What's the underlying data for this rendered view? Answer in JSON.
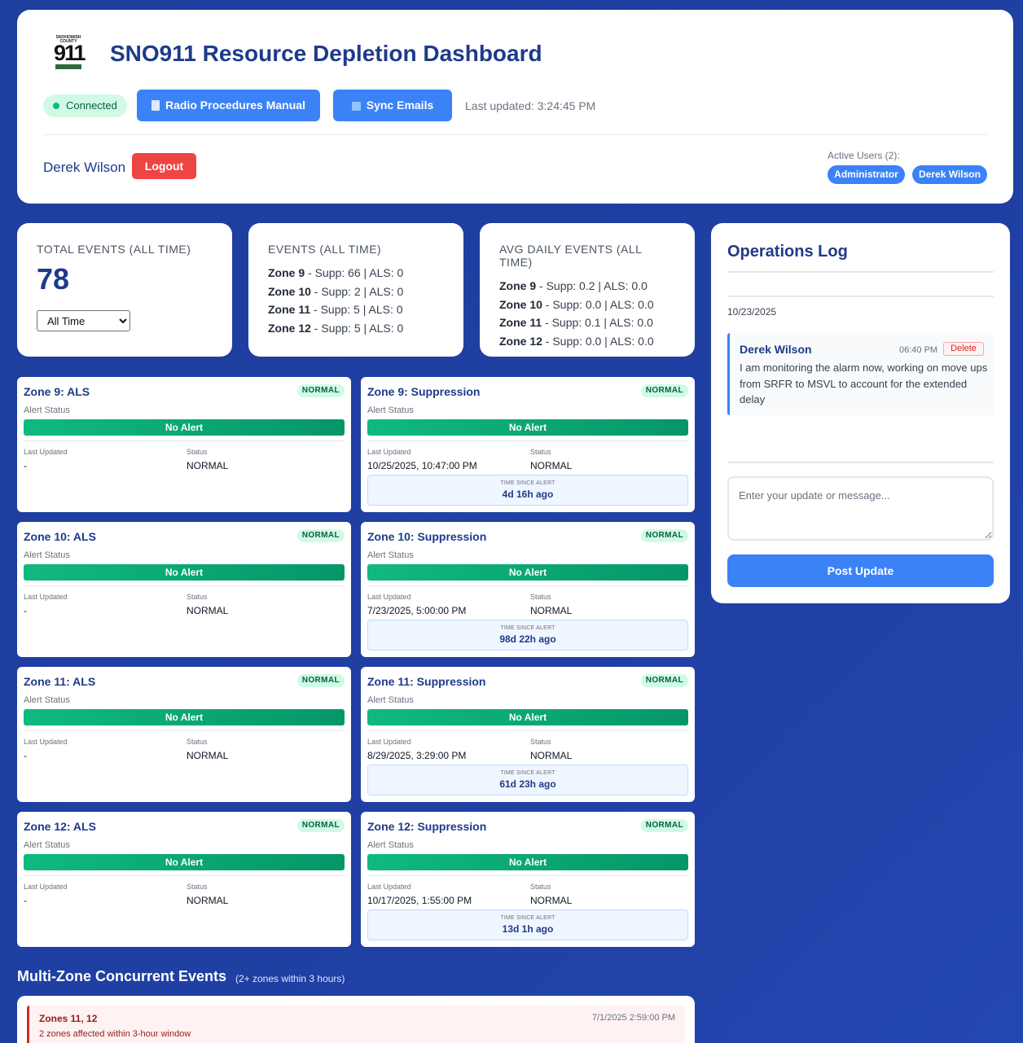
{
  "header": {
    "logo": {
      "top_text": "SNOHOMISH COUNTY",
      "number": "911"
    },
    "title": "SNO911 Resource Depletion Dashboard",
    "connection_status": "Connected",
    "radio_manual_label": "Radio Procedures Manual",
    "sync_emails_label": "Sync Emails",
    "last_updated": "Last updated: 3:24:45 PM",
    "username": "Derek Wilson",
    "logout_label": "Logout",
    "active_users_label": "Active Users (2):",
    "active_users": [
      "Administrator",
      "Derek Wilson"
    ]
  },
  "stats": {
    "total": {
      "title": "TOTAL EVENTS (ALL TIME)",
      "value": "78",
      "range_selected": "All Time"
    },
    "events": {
      "title": "EVENTS (ALL TIME)",
      "rows": [
        {
          "zone": "Zone 9",
          "detail": " - Supp: 66 | ALS: 0"
        },
        {
          "zone": "Zone 10",
          "detail": " - Supp: 2 | ALS: 0"
        },
        {
          "zone": "Zone 11",
          "detail": " - Supp: 5 | ALS: 0"
        },
        {
          "zone": "Zone 12",
          "detail": " - Supp: 5 | ALS: 0"
        }
      ]
    },
    "avg": {
      "title": "AVG DAILY EVENTS (ALL TIME)",
      "rows": [
        {
          "zone": "Zone 9",
          "detail": " - Supp: 0.2 | ALS: 0.0"
        },
        {
          "zone": "Zone 10",
          "detail": " - Supp: 0.0 | ALS: 0.0"
        },
        {
          "zone": "Zone 11",
          "detail": " - Supp: 0.1 | ALS: 0.0"
        },
        {
          "zone": "Zone 12",
          "detail": " - Supp: 0.0 | ALS: 0.0"
        }
      ]
    }
  },
  "zone_labels": {
    "alert_status": "Alert Status",
    "last_updated": "Last Updated",
    "status": "Status",
    "time_since": "TIME SINCE ALERT"
  },
  "zones": [
    {
      "title": "Zone 9: ALS",
      "badge": "NORMAL",
      "alert": "No Alert",
      "last_updated": "-",
      "status": "NORMAL",
      "since": ""
    },
    {
      "title": "Zone 9: Suppression",
      "badge": "NORMAL",
      "alert": "No Alert",
      "last_updated": "10/25/2025, 10:47:00 PM",
      "status": "NORMAL",
      "since": "4d 16h ago"
    },
    {
      "title": "Zone 10: ALS",
      "badge": "NORMAL",
      "alert": "No Alert",
      "last_updated": "-",
      "status": "NORMAL",
      "since": ""
    },
    {
      "title": "Zone 10: Suppression",
      "badge": "NORMAL",
      "alert": "No Alert",
      "last_updated": "7/23/2025, 5:00:00 PM",
      "status": "NORMAL",
      "since": "98d 22h ago"
    },
    {
      "title": "Zone 11: ALS",
      "badge": "NORMAL",
      "alert": "No Alert",
      "last_updated": "-",
      "status": "NORMAL",
      "since": ""
    },
    {
      "title": "Zone 11: Suppression",
      "badge": "NORMAL",
      "alert": "No Alert",
      "last_updated": "8/29/2025, 3:29:00 PM",
      "status": "NORMAL",
      "since": "61d 23h ago"
    },
    {
      "title": "Zone 12: ALS",
      "badge": "NORMAL",
      "alert": "No Alert",
      "last_updated": "-",
      "status": "NORMAL",
      "since": ""
    },
    {
      "title": "Zone 12: Suppression",
      "badge": "NORMAL",
      "alert": "No Alert",
      "last_updated": "10/17/2025, 1:55:00 PM",
      "status": "NORMAL",
      "since": "13d 1h ago"
    }
  ],
  "oplog": {
    "title": "Operations Log",
    "date": "10/23/2025",
    "entries": [
      {
        "user": "Derek Wilson",
        "time": "06:40 PM",
        "delete_label": "Delete",
        "message": "I am monitoring the alarm now, working on move ups from SRFR to MSVL to account for the extended delay"
      }
    ],
    "input_placeholder": "Enter your update or message...",
    "post_label": "Post Update"
  },
  "multizone": {
    "title": "Multi-Zone Concurrent Events",
    "subtitle": "(2+ zones within 3 hours)",
    "items": [
      {
        "zones": "Zones 11, 12",
        "time": "7/1/2025 2:59:00 PM",
        "desc": "2 zones affected within 3-hour window"
      }
    ]
  },
  "colors": {
    "background": "#1f3fa3",
    "primary": "#3b82f6",
    "title": "#1e3a8a",
    "ok": "#10b981",
    "danger": "#ef4444"
  }
}
